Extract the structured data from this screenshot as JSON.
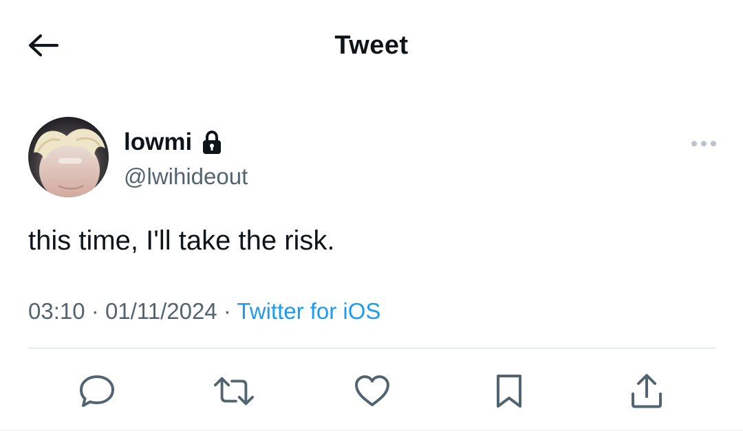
{
  "header": {
    "title": "Tweet",
    "back_icon": "arrow-left-icon"
  },
  "tweet": {
    "author": {
      "name": "lowmi",
      "handle": "@lwihideout",
      "protected_icon": "lock-icon",
      "avatar": "avatar-photo"
    },
    "more_icon": "more-horizontal-icon",
    "text": "this time, I'll take the risk.",
    "meta": {
      "time": "03:10",
      "separator": "·",
      "date": "01/11/2024",
      "source": "Twitter for iOS"
    },
    "actions": [
      {
        "name": "reply",
        "icon": "reply-icon"
      },
      {
        "name": "retweet",
        "icon": "retweet-icon"
      },
      {
        "name": "like",
        "icon": "heart-icon"
      },
      {
        "name": "bookmark",
        "icon": "bookmark-icon"
      },
      {
        "name": "share",
        "icon": "share-icon"
      }
    ]
  },
  "colors": {
    "text_primary": "#0f1419",
    "text_secondary": "#536471",
    "link": "#1d9bf0",
    "divider": "#cfd9de"
  }
}
